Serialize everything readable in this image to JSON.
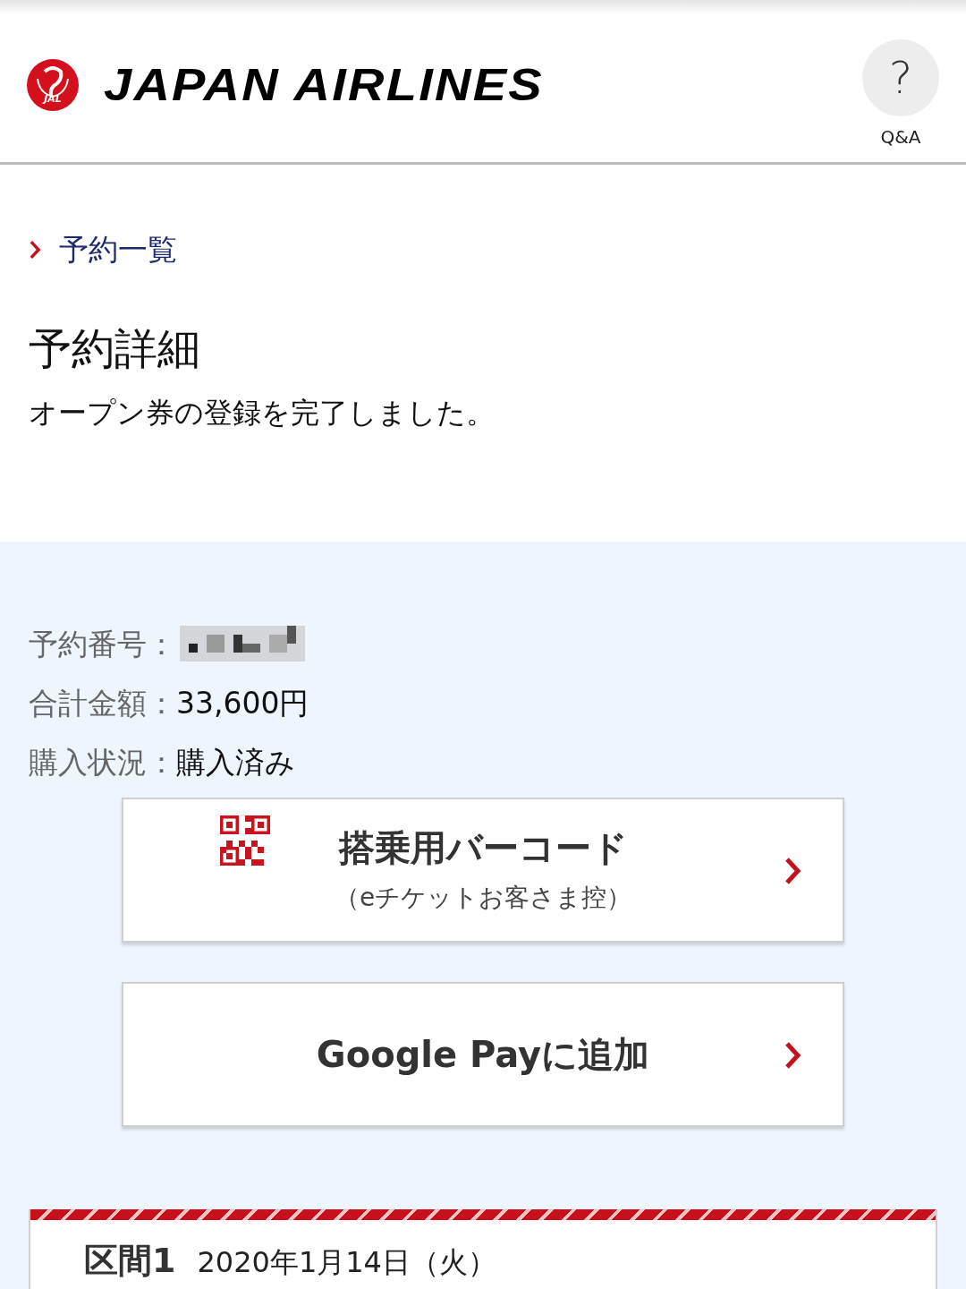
{
  "header": {
    "logo_badge": "JAL",
    "brand": "JAPAN AIRLINES",
    "help": {
      "symbol": "?",
      "label": "Q&A"
    }
  },
  "breadcrumb": {
    "label": "予約一覧"
  },
  "page_title": "予約詳細",
  "message": "オープン券の登録を完了しました。",
  "summary": [
    {
      "label": "予約番号：",
      "kind": "redacted"
    },
    {
      "label": "合計金額：",
      "kind": "text",
      "value": "33,600円"
    },
    {
      "label": "購入状況：",
      "kind": "text",
      "value": "購入済み"
    }
  ],
  "actions": [
    {
      "kind": "barcode",
      "title": "搭乗用バーコード",
      "subtitle": "（eチケットお客さま控）"
    },
    {
      "kind": "plain",
      "title": "Google Payに追加"
    }
  ],
  "segment": {
    "label": "区間1",
    "date": "2020年1月14日（火）"
  }
}
